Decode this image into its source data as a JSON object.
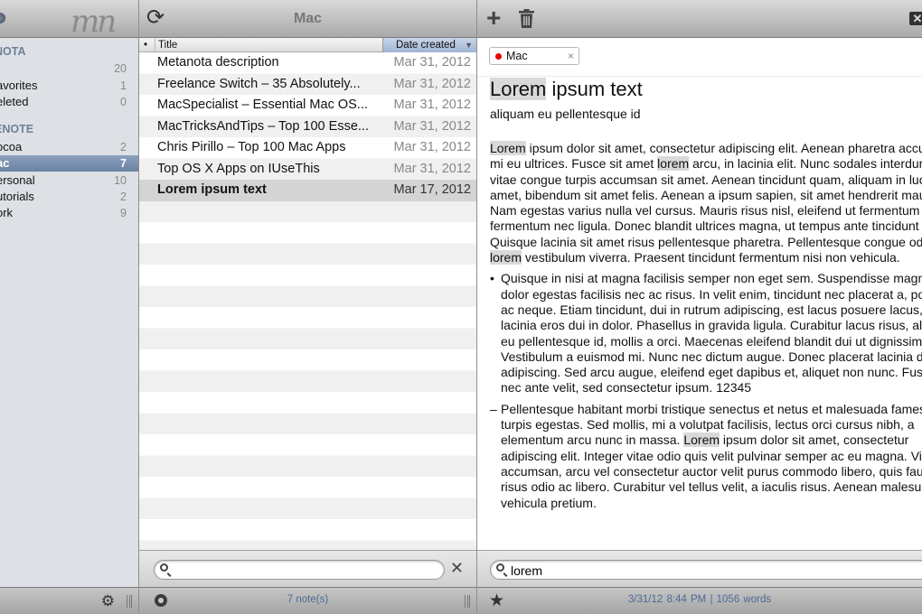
{
  "sidebar": {
    "logo": "mn",
    "groups": [
      {
        "title": "NOTA",
        "items": [
          {
            "label": "l",
            "count": "20"
          },
          {
            "label": "avorites",
            "count": "1"
          },
          {
            "label": "eleted",
            "count": "0"
          }
        ]
      },
      {
        "title": "ENOTE",
        "items": [
          {
            "label": "ocoa",
            "count": "2"
          },
          {
            "label": "ac",
            "count": "7"
          },
          {
            "label": "ersonal",
            "count": "10"
          },
          {
            "label": "utorials",
            "count": "2"
          },
          {
            "label": "ork",
            "count": "9"
          }
        ]
      }
    ]
  },
  "list": {
    "title": "Mac",
    "columns": {
      "bullet": "•",
      "title": "Title",
      "date": "Date created"
    },
    "notes": [
      {
        "title": "Metanota description",
        "date": "Mar 31, 2012"
      },
      {
        "title": "Freelance Switch – 35 Absolutely...",
        "date": "Mar 31, 2012"
      },
      {
        "title": "MacSpecialist – Essential Mac OS...",
        "date": "Mar 31, 2012"
      },
      {
        "title": "MacTricksAndTips – Top 100 Esse...",
        "date": "Mar 31, 2012"
      },
      {
        "title": "Chris Pirillo – Top 100 Mac Apps",
        "date": "Mar 31, 2012"
      },
      {
        "title": "Top OS X Apps on IUseThis",
        "date": "Mar 31, 2012"
      },
      {
        "title": "Lorem ipsum text",
        "date": "Mar 17, 2012"
      }
    ],
    "search": {
      "value": ""
    },
    "status": "7 note(s)"
  },
  "editor": {
    "tag": "Mac",
    "title_hl": "Lorem",
    "title_rest": " ipsum text",
    "subtitle": "aliquam eu pellentesque id",
    "p1": [
      "Lorem",
      " ipsum dolor sit amet, consectetur adipiscing elit. Aenean pharetra accumsan mi eu ultrices. Fusce sit amet ",
      "lorem",
      " arcu, in lacinia elit. Nunc sodales interdum est, vitae congue turpis accumsan sit amet. Aenean tincidunt quam, aliquam in luctus sit amet, bibendum sit amet felis. Aenean a ipsum sapien, sit amet hendrerit mauris. Nam egestas varius nulla vel cursus. Mauris risus nisl, eleifend ut fermentum eget, fermentum nec ligula. Donec blandit ultrices magna, ut tempus ante tincidunt quis. Quisque lacinia sit amet risus pellentesque pharetra. Pellentesque congue odio sed ",
      "lorem",
      " vestibulum viverra. Praesent tincidunt fermentum nisi non vehicula."
    ],
    "li1_marker": "•",
    "li1": "Quisque in nisi at magna facilisis semper non eget sem. Suspendisse magna quis dolor egestas facilisis nec ac risus. In velit enim, tincidunt nec placerat a, porttitor ac neque. Etiam tincidunt, dui in rutrum adipiscing, est lacus posuere lacus, a lacinia eros dui in dolor. Phasellus in gravida ligula. Curabitur lacus risus, aliquam eu pellentesque id, mollis a orci. Maecenas eleifend blandit dui ut dignissim. Vestibulum a euismod mi. Nunc nec dictum augue. Donec placerat lacinia dolor id adipiscing. Sed arcu augue, eleifend eget dapibus et, aliquet non nunc. Fusce nec ante velit, sed consectetur ipsum. 12345",
    "li2_marker": "–",
    "li2_a": "Pellentesque habitant morbi tristique senectus et netus et malesuada fames ac turpis egestas. Sed mollis, mi a volutpat facilisis, lectus orci cursus nibh, a elementum arcu nunc in massa. ",
    "li2_hl": "Lorem",
    "li2_b": " ipsum dolor sit amet, consectetur adipiscing elit. Integer vitae odio quis velit pulvinar semper ac eu magna. Vivamus accumsan, arcu vel consectetur auctor velit purus commodo libero, quis faucibus risus odio ac libero. Curabitur vel tellus velit, a iaculis risus. Aenean malesuada vehicula pretium.",
    "search": {
      "value": "lorem"
    },
    "status": "3/31/12 8:44 PM  |  1056 words"
  },
  "colors": {
    "accent": "#4b6b95",
    "selection": "#6a82a3",
    "tag_dot": "#e00000",
    "highlight": "#d9d9d9"
  }
}
